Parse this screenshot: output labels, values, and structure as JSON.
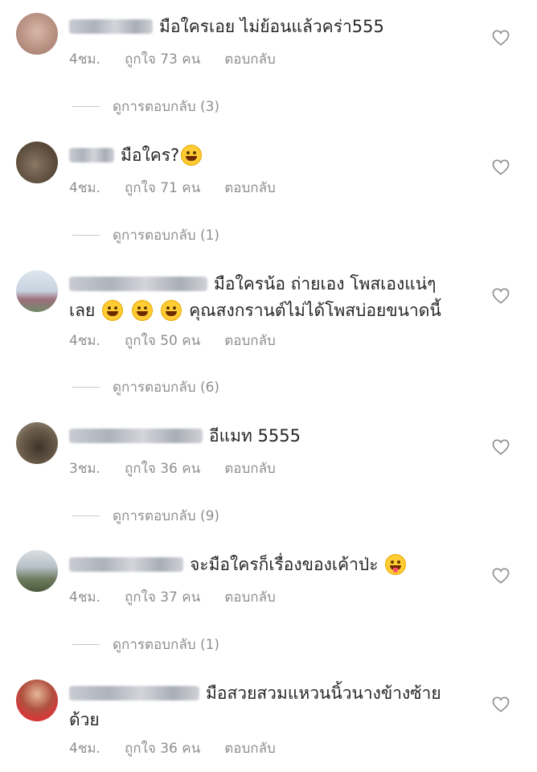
{
  "comments": [
    {
      "text": "มือใครเอย ไม่ย้อนแล้วคร่า555",
      "text2": "",
      "time": "4ชม.",
      "likes": "ถูกใจ 73 คน",
      "reply": "ตอบกลับ",
      "view_replies": "ดูการตอบกลับ (3)",
      "avatar_color": "#c9a89a"
    },
    {
      "text": "มือใคร?",
      "text2": "",
      "time": "4ชม.",
      "likes": "ถูกใจ 71 คน",
      "reply": "ตอบกลับ",
      "view_replies": "ดูการตอบกลับ (1)",
      "avatar_color": "#6b5a45"
    },
    {
      "text": "มือใครน้อ ถ่ายเอง โพสเองแน่ๆ",
      "text2_a": "เลย",
      "text2_b": "คุณสงกรานต์ไม่ได้โพสบ่อยขนาดนี้",
      "time": "4ชม.",
      "likes": "ถูกใจ 50 คน",
      "reply": "ตอบกลับ",
      "view_replies": "ดูการตอบกลับ (6)",
      "avatar_color": "#8fa7c0"
    },
    {
      "text": "อีแมท 5555",
      "text2": "",
      "time": "3ชม.",
      "likes": "ถูกใจ 36 คน",
      "reply": "ตอบกลับ",
      "view_replies": "ดูการตอบกลับ (9)",
      "avatar_color": "#5e5040"
    },
    {
      "text": "จะมือใครก็เรื่องของเค้าป่ะ",
      "text2": "",
      "time": "4ชม.",
      "likes": "ถูกใจ 37 คน",
      "reply": "ตอบกลับ",
      "view_replies": "ดูการตอบกลับ (1)",
      "avatar_color": "#7d8a70"
    },
    {
      "text": "มือสวยสวมแหวนนิ้วนางข้างซ้าย",
      "text2": "ด้วย",
      "time": "4ชม.",
      "likes": "ถูกใจ 36 คน",
      "reply": "ตอบกลับ",
      "view_replies": "",
      "avatar_color": "#c4453e"
    }
  ],
  "icons": {
    "heart": "heart-icon",
    "emoji_laugh": "joy-emoji",
    "emoji_grin": "grin-emoji",
    "emoji_tongue": "tongue-emoji"
  },
  "colors": {
    "meta": "#8e8e8e",
    "text": "#262626"
  }
}
